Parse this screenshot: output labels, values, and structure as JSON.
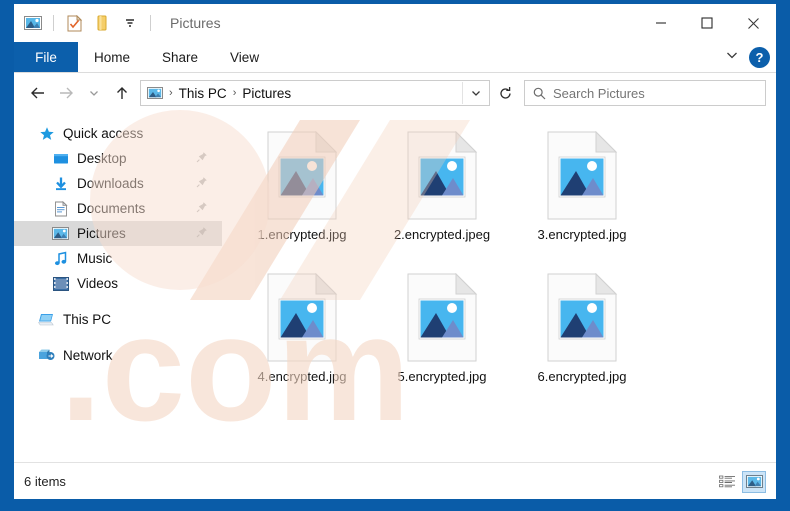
{
  "window": {
    "title": "Pictures",
    "quick_access_icons": [
      "picture-icon",
      "properties-icon",
      "new-folder-icon",
      "customize-dropdown-icon"
    ],
    "controls": {
      "minimize": "minimize-button",
      "maximize": "maximize-button",
      "close": "close-button"
    }
  },
  "ribbon": {
    "file_tab": "File",
    "tabs": [
      "Home",
      "Share",
      "View"
    ],
    "expand_label": "expand-ribbon",
    "help_label": "?"
  },
  "navbar": {
    "back": "back-button",
    "forward": "forward-button",
    "recent": "recent-locations-button",
    "up": "up-button",
    "breadcrumb": [
      "This PC",
      "Pictures"
    ],
    "breadcrumb_separator": "›",
    "dropdown": "previous-locations",
    "refresh": "refresh-button"
  },
  "search": {
    "placeholder": "Search Pictures",
    "value": ""
  },
  "sidebar": {
    "items": [
      {
        "label": "Quick access",
        "icon": "star-icon",
        "level": "root",
        "pinned": false,
        "selected": false
      },
      {
        "label": "Desktop",
        "icon": "desktop-icon",
        "level": "child",
        "pinned": true,
        "selected": false
      },
      {
        "label": "Downloads",
        "icon": "downloads-icon",
        "level": "child",
        "pinned": true,
        "selected": false
      },
      {
        "label": "Documents",
        "icon": "documents-icon",
        "level": "child",
        "pinned": true,
        "selected": false
      },
      {
        "label": "Pictures",
        "icon": "pictures-icon",
        "level": "child",
        "pinned": true,
        "selected": true
      },
      {
        "label": "Music",
        "icon": "music-icon",
        "level": "child",
        "pinned": false,
        "selected": false
      },
      {
        "label": "Videos",
        "icon": "videos-icon",
        "level": "child",
        "pinned": false,
        "selected": false
      },
      {
        "label": "This PC",
        "icon": "this-pc-icon",
        "level": "root",
        "pinned": false,
        "selected": false
      },
      {
        "label": "Network",
        "icon": "network-icon",
        "level": "root",
        "pinned": false,
        "selected": false
      }
    ]
  },
  "files": [
    {
      "name": "1.encrypted.jpg",
      "icon": "image-file-icon"
    },
    {
      "name": "2.encrypted.jpeg",
      "icon": "image-file-icon"
    },
    {
      "name": "3.encrypted.jpg",
      "icon": "image-file-icon"
    },
    {
      "name": "4.encrypted.jpg",
      "icon": "image-file-icon"
    },
    {
      "name": "5.encrypted.jpg",
      "icon": "image-file-icon"
    },
    {
      "name": "6.encrypted.jpg",
      "icon": "image-file-icon"
    }
  ],
  "status": {
    "item_count": "6 items",
    "view_details": "details-view-button",
    "view_large_icons": "large-icons-view-button",
    "active_view": "large-icons"
  },
  "colors": {
    "accent": "#0c5fab",
    "window_border": "#0a5ca8",
    "selection": "#d9d9d9",
    "view_active": "#cce4f7"
  }
}
